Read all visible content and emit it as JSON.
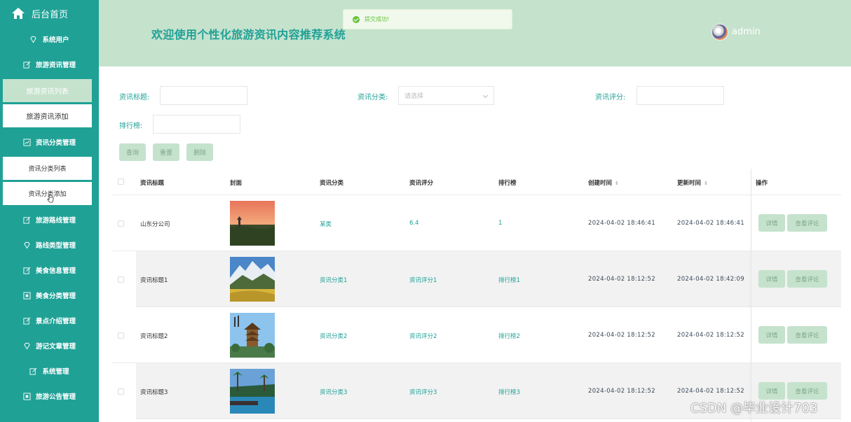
{
  "sidebar": {
    "home_label": "后台首页",
    "items": [
      {
        "label": "系统用户",
        "icon": "diamond-icon",
        "type": "menu"
      },
      {
        "label": "旅游资讯管理",
        "icon": "edit-icon",
        "type": "menu"
      },
      {
        "label": "旅游资讯列表",
        "type": "sub",
        "active": true
      },
      {
        "label": "旅游资讯添加",
        "type": "sub"
      },
      {
        "label": "资讯分类管理",
        "icon": "chart-icon",
        "type": "menu"
      },
      {
        "label": "资讯分类列表",
        "type": "sub"
      },
      {
        "label": "资讯分类添加",
        "type": "sub"
      },
      {
        "label": "旅游路线管理",
        "icon": "edit-icon",
        "type": "menu"
      },
      {
        "label": "路线类型管理",
        "icon": "diamond-icon",
        "type": "menu"
      },
      {
        "label": "美食信息管理",
        "icon": "edit-icon",
        "type": "menu"
      },
      {
        "label": "美食分类管理",
        "icon": "box-icon",
        "type": "menu"
      },
      {
        "label": "景点介绍管理",
        "icon": "edit-icon",
        "type": "menu"
      },
      {
        "label": "游记文章管理",
        "icon": "diamond-icon",
        "type": "menu"
      },
      {
        "label": "系统管理",
        "icon": "edit-icon",
        "type": "menu"
      },
      {
        "label": "旅游公告管理",
        "icon": "box-icon",
        "type": "menu"
      }
    ]
  },
  "header": {
    "title": "欢迎使用个性化旅游资讯内容推荐系统",
    "username": "admin"
  },
  "toast": {
    "message": "提交成功!"
  },
  "search": {
    "title_label": "资讯标题:",
    "category_label": "资讯分类:",
    "category_placeholder": "请选择",
    "rating_label": "资讯评分:",
    "rank_label": "排行榜:",
    "query_btn": "查询",
    "reset_btn": "重置",
    "delete_btn": "删除"
  },
  "table": {
    "headers": {
      "title": "资讯标题",
      "cover": "封面",
      "category": "资讯分类",
      "rating": "资讯评分",
      "rank": "排行榜",
      "created": "创建时间",
      "updated": "更新时间",
      "ops": "操作"
    },
    "detail_btn": "详情",
    "comment_btn": "查看评论",
    "rows": [
      {
        "title": "山东分公司",
        "category": "某类",
        "rating": "6.4",
        "rank": "1",
        "created": "2024-04-02 18:46:41",
        "updated": "2024-04-02 18:46:41"
      },
      {
        "title": "资讯标题1",
        "category": "资讯分类1",
        "rating": "资讯评分1",
        "rank": "排行榜1",
        "created": "2024-04-02 18:12:52",
        "updated": "2024-04-02 18:42:09"
      },
      {
        "title": "资讯标题2",
        "category": "资讯分类2",
        "rating": "资讯评分2",
        "rank": "排行榜2",
        "created": "2024-04-02 18:12:52",
        "updated": "2024-04-02 18:12:52"
      },
      {
        "title": "资讯标题3",
        "category": "资讯分类3",
        "rating": "资讯评分3",
        "rank": "排行榜3",
        "created": "2024-04-02 18:12:52",
        "updated": "2024-04-02 18:12:52"
      }
    ]
  },
  "watermark": "CSDN @毕业设计703"
}
